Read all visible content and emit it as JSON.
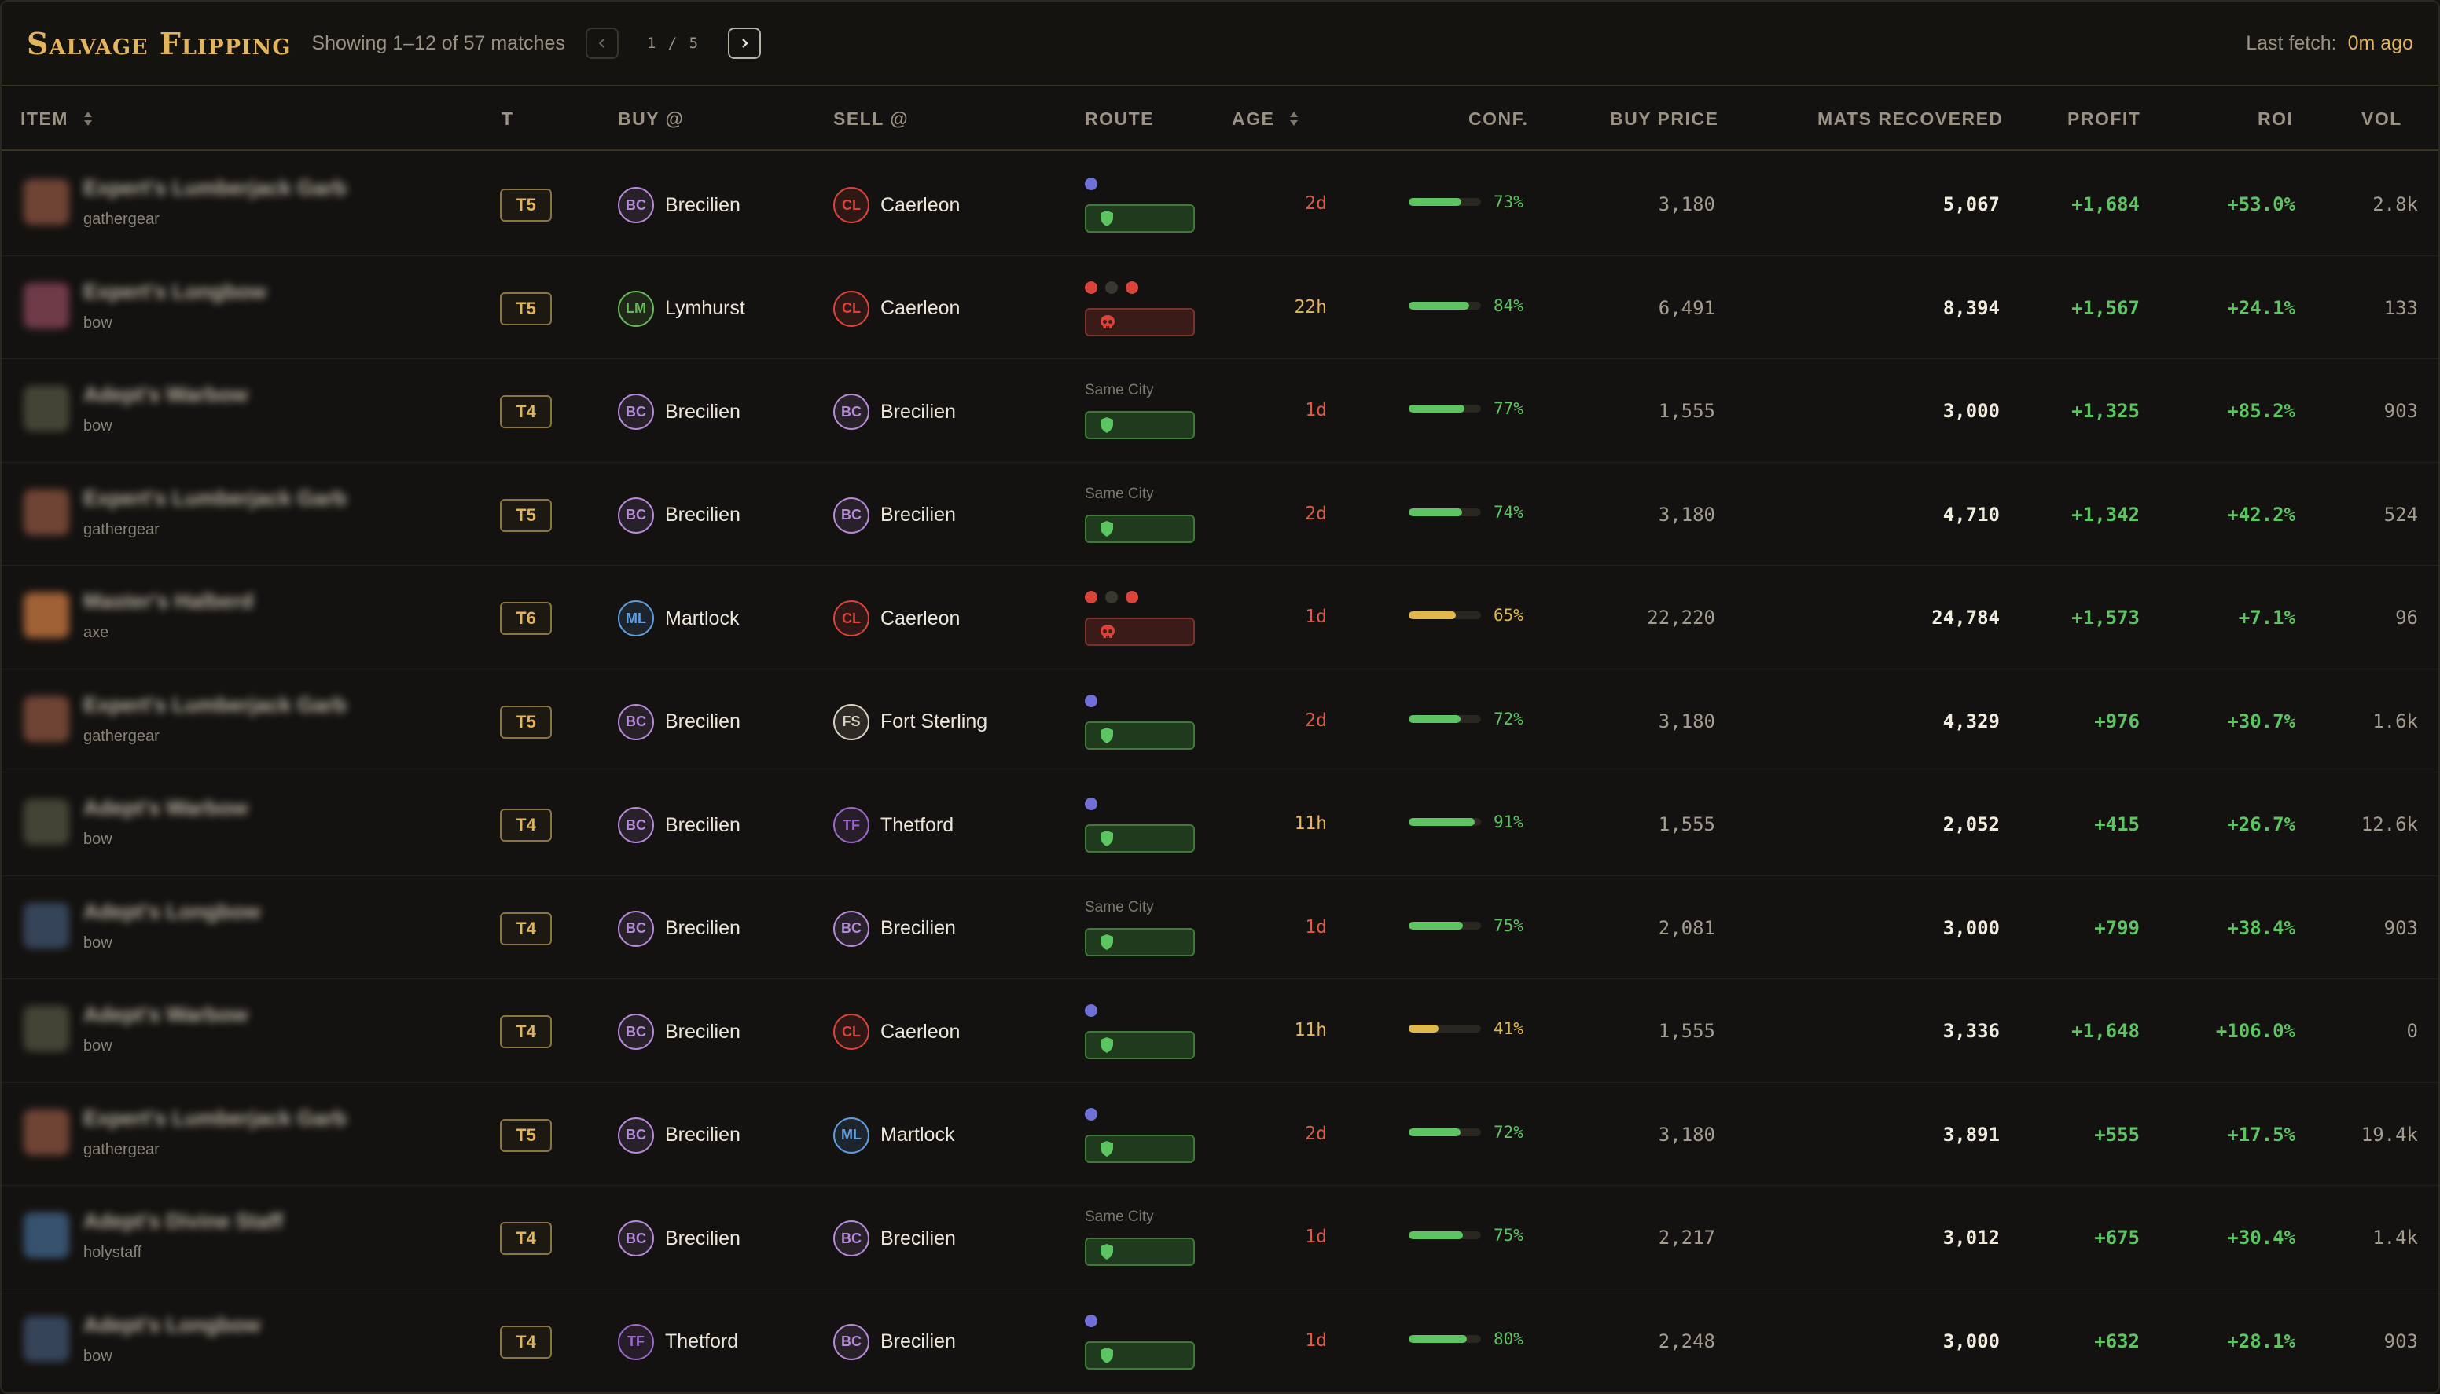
{
  "header": {
    "title": "Salvage Flipping",
    "match_text": "Showing 1–12 of 57 matches",
    "page_indicator": "1 / 5",
    "prev_icon": "chevron-left-icon",
    "next_icon": "chevron-right-icon",
    "last_fetch_label": "Last fetch:",
    "last_fetch_value": "0m ago"
  },
  "columns": {
    "item": "ITEM",
    "tier": "T",
    "buy_at": "BUY @",
    "sell_at": "SELL @",
    "route": "ROUTE",
    "age": "AGE",
    "conf": "CONF.",
    "buy_price": "BUY PRICE",
    "mats": "MATS RECOVERED",
    "profit": "PROFIT",
    "roi": "ROI",
    "vol": "VOL"
  },
  "colors": {
    "accent": "#e3b45e",
    "positive": "#5cc460",
    "warning": "#e1b84c",
    "danger": "#d9433a",
    "age_red": "#e05a4a",
    "age_amber": "#e3b45e"
  },
  "cities": {
    "BC": {
      "name": "Brecilien",
      "color": "#b58ad8"
    },
    "CL": {
      "name": "Caerleon",
      "color": "#d9433a"
    },
    "LM": {
      "name": "Lymhurst",
      "color": "#66b85a"
    },
    "ML": {
      "name": "Martlock",
      "color": "#5e9ee0"
    },
    "FS": {
      "name": "Fort Sterling",
      "color": "#d8d2c4"
    },
    "TF": {
      "name": "Thetford",
      "color": "#9a68c8"
    }
  },
  "rows": [
    {
      "name": "Expert's Lumberjack Garb",
      "category": "gathergear",
      "thumb": "#7a4a3a",
      "tier": "T5",
      "buy": "BC",
      "sell": "CL",
      "route": "dot",
      "safety": "safe",
      "age": "2d",
      "age_tone": "red",
      "conf": 73,
      "buy_price": "3,180",
      "mats": "5,067",
      "profit": "+1,684",
      "roi": "+53.0%",
      "vol": "2.8k"
    },
    {
      "name": "Expert's Longbow",
      "category": "bow",
      "thumb": "#7a4050",
      "tier": "T5",
      "buy": "LM",
      "sell": "CL",
      "route": "dots3",
      "safety": "danger",
      "age": "22h",
      "age_tone": "amber",
      "conf": 84,
      "buy_price": "6,491",
      "mats": "8,394",
      "profit": "+1,567",
      "roi": "+24.1%",
      "vol": "133"
    },
    {
      "name": "Adept's Warbow",
      "category": "bow",
      "thumb": "#4a4a3a",
      "tier": "T4",
      "buy": "BC",
      "sell": "BC",
      "route": "same",
      "route_text": "Same City",
      "safety": "safe",
      "age": "1d",
      "age_tone": "red",
      "conf": 77,
      "buy_price": "1,555",
      "mats": "3,000",
      "profit": "+1,325",
      "roi": "+85.2%",
      "vol": "903"
    },
    {
      "name": "Expert's Lumberjack Garb",
      "category": "gathergear",
      "thumb": "#7a4a3a",
      "tier": "T5",
      "buy": "BC",
      "sell": "BC",
      "route": "same",
      "route_text": "Same City",
      "safety": "safe",
      "age": "2d",
      "age_tone": "red",
      "conf": 74,
      "buy_price": "3,180",
      "mats": "4,710",
      "profit": "+1,342",
      "roi": "+42.2%",
      "vol": "524"
    },
    {
      "name": "Master's Halberd",
      "category": "axe",
      "thumb": "#b06a3a",
      "tier": "T6",
      "buy": "ML",
      "sell": "CL",
      "route": "dots3",
      "safety": "danger",
      "age": "1d",
      "age_tone": "red",
      "conf": 65,
      "buy_price": "22,220",
      "mats": "24,784",
      "profit": "+1,573",
      "roi": "+7.1%",
      "vol": "96"
    },
    {
      "name": "Expert's Lumberjack Garb",
      "category": "gathergear",
      "thumb": "#7a4a3a",
      "tier": "T5",
      "buy": "BC",
      "sell": "FS",
      "route": "dot",
      "safety": "safe",
      "age": "2d",
      "age_tone": "red",
      "conf": 72,
      "buy_price": "3,180",
      "mats": "4,329",
      "profit": "+976",
      "roi": "+30.7%",
      "vol": "1.6k"
    },
    {
      "name": "Adept's Warbow",
      "category": "bow",
      "thumb": "#4a4a3a",
      "tier": "T4",
      "buy": "BC",
      "sell": "TF",
      "route": "dot",
      "safety": "safe",
      "age": "11h",
      "age_tone": "amber",
      "conf": 91,
      "buy_price": "1,555",
      "mats": "2,052",
      "profit": "+415",
      "roi": "+26.7%",
      "vol": "12.6k"
    },
    {
      "name": "Adept's Longbow",
      "category": "bow",
      "thumb": "#3a4a62",
      "tier": "T4",
      "buy": "BC",
      "sell": "BC",
      "route": "same",
      "route_text": "Same City",
      "safety": "safe",
      "age": "1d",
      "age_tone": "red",
      "conf": 75,
      "buy_price": "2,081",
      "mats": "3,000",
      "profit": "+799",
      "roi": "+38.4%",
      "vol": "903"
    },
    {
      "name": "Adept's Warbow",
      "category": "bow",
      "thumb": "#4a4a3a",
      "tier": "T4",
      "buy": "BC",
      "sell": "CL",
      "route": "dot",
      "safety": "safe",
      "age": "11h",
      "age_tone": "amber",
      "conf": 41,
      "buy_price": "1,555",
      "mats": "3,336",
      "profit": "+1,648",
      "roi": "+106.0%",
      "vol": "0"
    },
    {
      "name": "Expert's Lumberjack Garb",
      "category": "gathergear",
      "thumb": "#7a4a3a",
      "tier": "T5",
      "buy": "BC",
      "sell": "ML",
      "route": "dot",
      "safety": "safe",
      "age": "2d",
      "age_tone": "red",
      "conf": 72,
      "buy_price": "3,180",
      "mats": "3,891",
      "profit": "+555",
      "roi": "+17.5%",
      "vol": "19.4k"
    },
    {
      "name": "Adept's Divine Staff",
      "category": "holystaff",
      "thumb": "#3a5a7a",
      "tier": "T4",
      "buy": "BC",
      "sell": "BC",
      "route": "same",
      "route_text": "Same City",
      "safety": "safe",
      "age": "1d",
      "age_tone": "red",
      "conf": 75,
      "buy_price": "2,217",
      "mats": "3,012",
      "profit": "+675",
      "roi": "+30.4%",
      "vol": "1.4k"
    },
    {
      "name": "Adept's Longbow",
      "category": "bow",
      "thumb": "#3a4a62",
      "tier": "T4",
      "buy": "TF",
      "sell": "BC",
      "route": "dot",
      "safety": "safe",
      "age": "1d",
      "age_tone": "red",
      "conf": 80,
      "buy_price": "2,248",
      "mats": "3,000",
      "profit": "+632",
      "roi": "+28.1%",
      "vol": "903"
    }
  ]
}
